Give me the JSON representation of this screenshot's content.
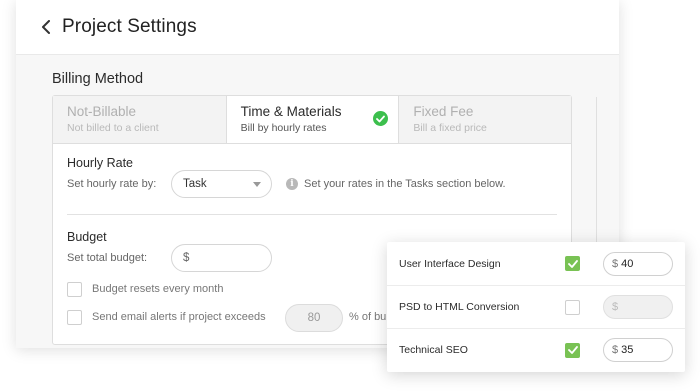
{
  "header": {
    "title": "Project Settings",
    "back_icon": "chevron-left-icon"
  },
  "billing": {
    "section_title": "Billing Method",
    "tabs": [
      {
        "title": "Not-Billable",
        "subtitle": "Not billed to a client",
        "active": false
      },
      {
        "title": "Time & Materials",
        "subtitle": "Bill by hourly rates",
        "active": true
      },
      {
        "title": "Fixed Fee",
        "subtitle": "Bill a fixed price",
        "active": false
      }
    ],
    "active_badge_color": "#3cbf4d"
  },
  "hourly_rate": {
    "title": "Hourly Rate",
    "set_by_label": "Set hourly rate by:",
    "selected": "Task",
    "info_text": "Set your rates in the Tasks section below."
  },
  "budget": {
    "title": "Budget",
    "total_label": "Set total budget:",
    "currency": "$",
    "resets_label": "Budget resets every month",
    "alert_label": "Send email alerts if project exceeds",
    "alert_value": "80",
    "alert_suffix": "% of bu"
  },
  "tasks": [
    {
      "name": "User Interface Design",
      "checked": true,
      "currency": "$",
      "rate": "40"
    },
    {
      "name": "PSD to HTML Conversion",
      "checked": false,
      "currency": "$",
      "rate": ""
    },
    {
      "name": "Technical SEO",
      "checked": true,
      "currency": "$",
      "rate": "35"
    }
  ],
  "colors": {
    "check_green": "#79c254"
  }
}
